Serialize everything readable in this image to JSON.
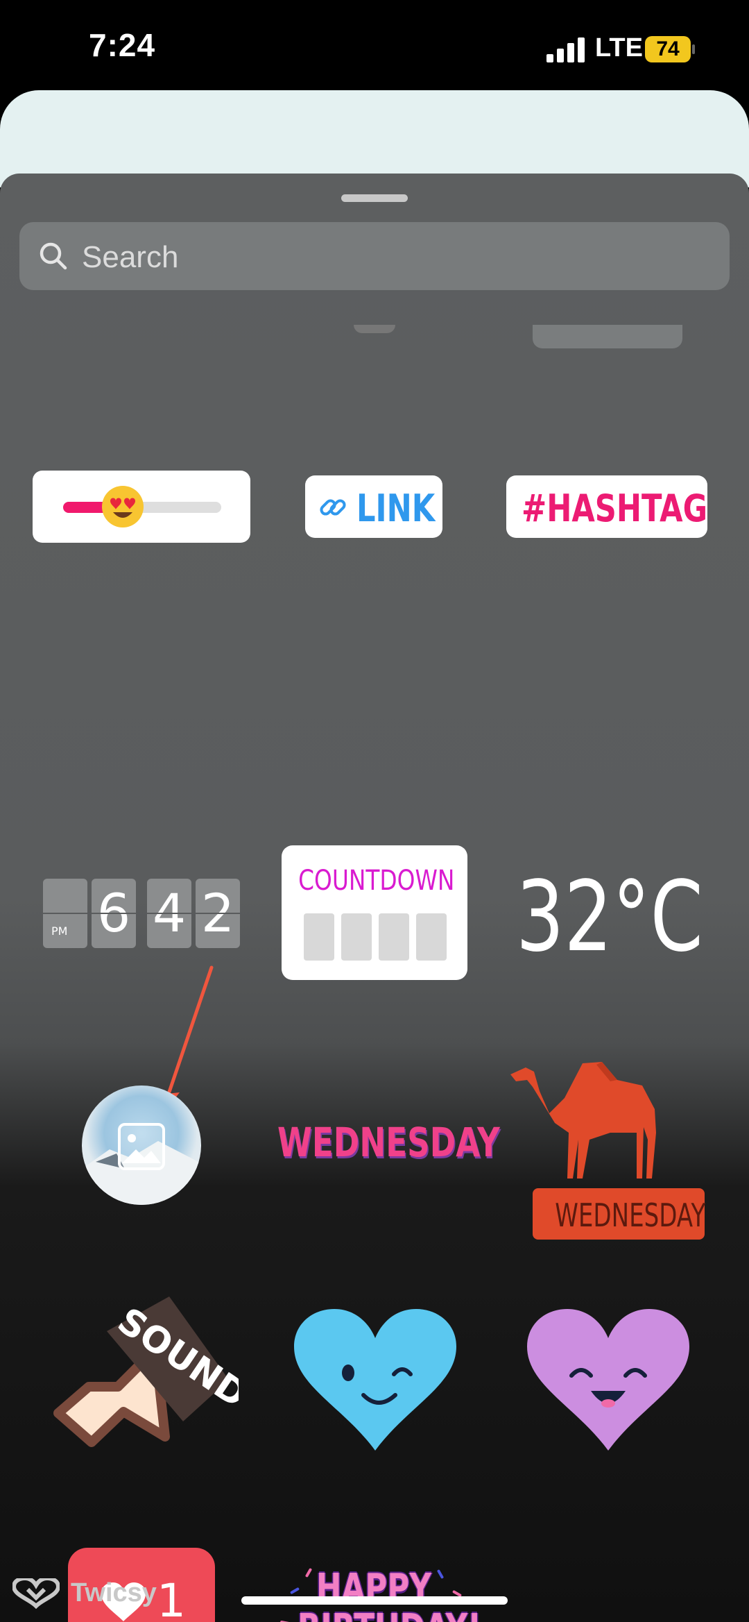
{
  "status_bar": {
    "time": "7:24",
    "network": "LTE",
    "battery": "74"
  },
  "search": {
    "placeholder": "Search"
  },
  "stickers": {
    "link": {
      "label": "LINK"
    },
    "hashtag": {
      "label": "#HASHTAG"
    },
    "clock": {
      "period": "PM",
      "digits": [
        "",
        "6",
        "4",
        "2"
      ]
    },
    "countdown": {
      "label": "COUNTDOWN"
    },
    "temperature": {
      "label": "32°C"
    },
    "day_text": {
      "label": "WEDNESDAY"
    },
    "camel_day": {
      "label": "WEDNESDAY"
    },
    "sound_on": {
      "label": "SOUND ON"
    },
    "like": {
      "count": "1"
    },
    "birthday": {
      "line1": "HAPPY",
      "line2": "BIRTHDAY!"
    }
  },
  "brand": {
    "name": "Twicsy"
  },
  "colors": {
    "hashtag": "#ec1b73",
    "link": "#2f98ed",
    "slider_fill": "#f0196c",
    "countdown": "#d91bd0",
    "like": "#ee4a57",
    "camel": "#e04a2a",
    "heart_blue": "#5bc8f0",
    "heart_purple": "#cc8ee0"
  }
}
